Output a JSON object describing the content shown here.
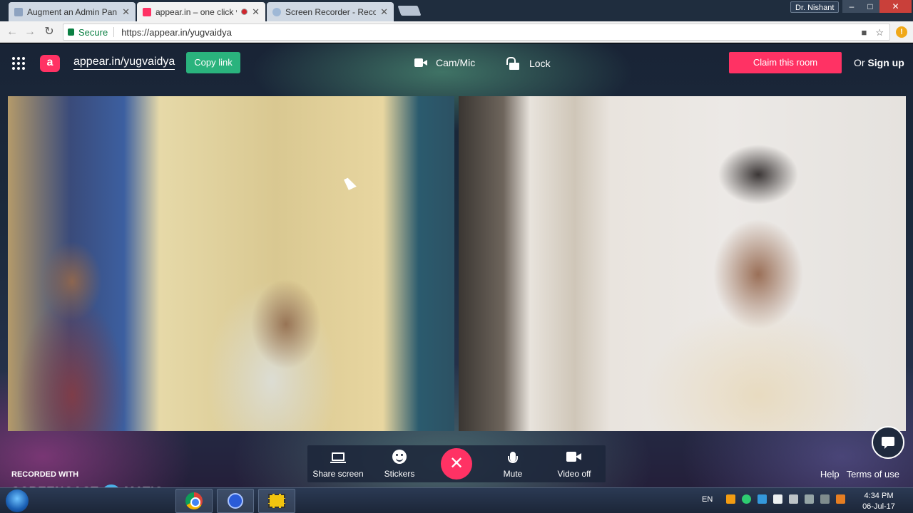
{
  "browser": {
    "tabs": [
      {
        "title": "Augment an Admin Pan",
        "active": false
      },
      {
        "title": "appear.in – one click v",
        "active": true,
        "recording": true
      },
      {
        "title": "Screen Recorder - Record",
        "active": false
      }
    ],
    "profile_name": "Dr. Nishant",
    "window_controls": {
      "minimize": "–",
      "maximize": "□",
      "close": "✕"
    },
    "secure_label": "Secure",
    "url": "https://appear.in/yugvaidya",
    "extension_badge": "!"
  },
  "app": {
    "logo_letter": "a",
    "room_url": "appear.in/yugvaidya",
    "copy_link": "Copy link",
    "cam_mic": "Cam/Mic",
    "lock": "Lock",
    "claim_room": "Claim this room",
    "or": "Or",
    "sign_up": "Sign up",
    "controls": {
      "share_screen": "Share screen",
      "stickers": "Stickers",
      "hangup": "✕",
      "mute": "Mute",
      "video_off": "Video off"
    },
    "help": "Help",
    "terms": "Terms of use",
    "colors": {
      "accent_pink": "#ff3264",
      "accent_green": "#2ab37d"
    }
  },
  "watermark": {
    "recorded_with": "RECORDED WITH",
    "brand_left": "SCREENCAST",
    "brand_right": "MATIC"
  },
  "taskbar": {
    "language": "EN",
    "time": "4:34 PM",
    "date": "06-Jul-17"
  }
}
